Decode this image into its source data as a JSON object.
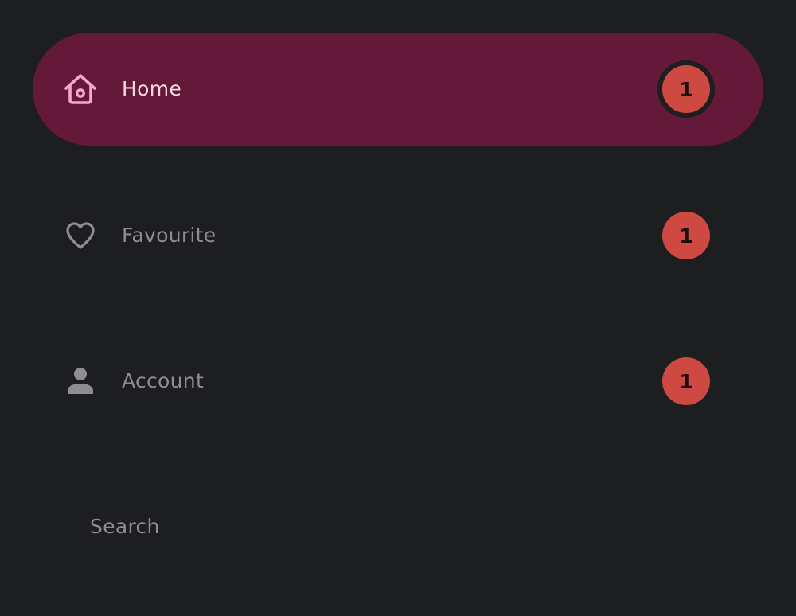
{
  "colors": {
    "background": "#1d1e20",
    "active_pill": "#641939",
    "active_text": "#f7d8e3",
    "inactive_text": "#8f8c93",
    "badge": "#cf4943"
  },
  "nav": {
    "items": [
      {
        "label": "Home",
        "icon": "home-icon",
        "badge": "1",
        "active": true
      },
      {
        "label": "Favourite",
        "icon": "heart-icon",
        "badge": "1",
        "active": false
      },
      {
        "label": "Account",
        "icon": "person-icon",
        "badge": "1",
        "active": false
      }
    ],
    "search_label": "Search"
  }
}
